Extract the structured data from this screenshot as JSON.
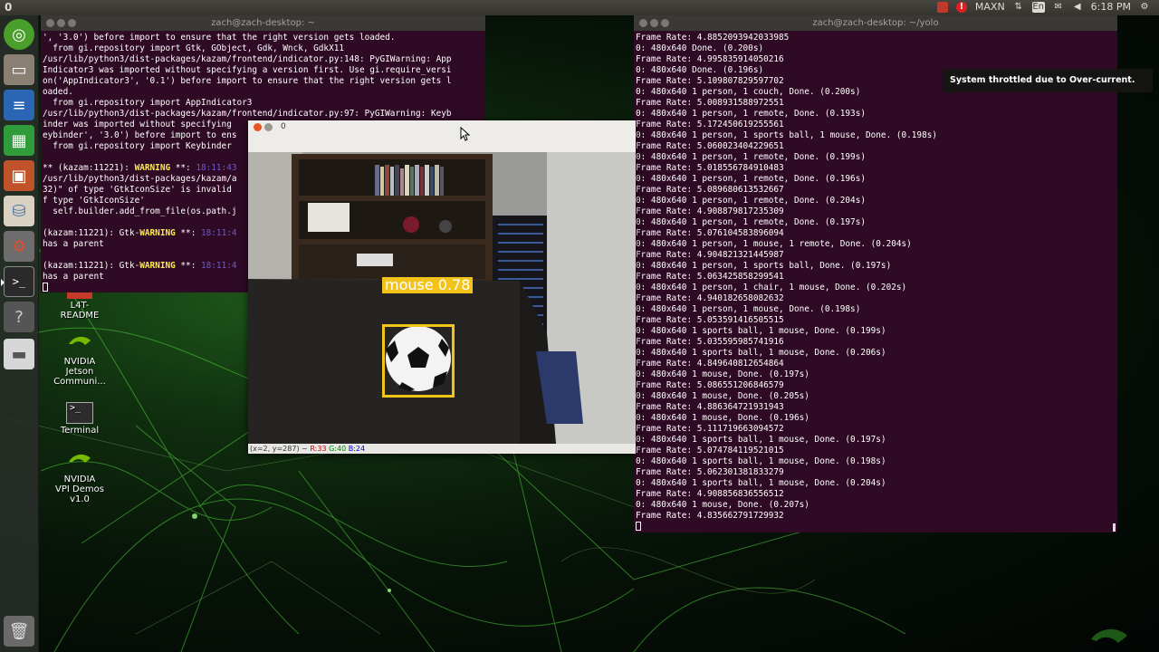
{
  "top_panel": {
    "left_label": "0",
    "network": "MAXN",
    "keyboard": "En",
    "clock": "6:18 PM"
  },
  "launcher": {
    "icons": [
      "ubuntu-logo-icon",
      "files-icon",
      "writer-icon",
      "calc-icon",
      "impress-icon",
      "software-center-icon",
      "settings-icon",
      "terminal-icon",
      "help-icon",
      "drive-icon",
      "trash-icon"
    ]
  },
  "desktop_icons": [
    {
      "label": "L4T-\nREADME",
      "icon": "readme-icon"
    },
    {
      "label": "NVIDIA\nJetson\nCommuni...",
      "icon": "nvidia-icon"
    },
    {
      "label": "Terminal",
      "icon": "terminal-icon"
    },
    {
      "label": "NVIDIA\nVPI Demos\nv1.0",
      "icon": "nvidia-icon"
    }
  ],
  "left_terminal": {
    "title": "zach@zach-desktop: ~",
    "lines": [
      "', '3.0') before import to ensure that the right version gets loaded.",
      "  from gi.repository import Gtk, GObject, Gdk, Wnck, GdkX11",
      "/usr/lib/python3/dist-packages/kazam/frontend/indicator.py:148: PyGIWarning: App",
      "Indicator3 was imported without specifying a version first. Use gi.require_versi",
      "on('AppIndicator3', '0.1') before import to ensure that the right version gets l",
      "oaded.",
      "  from gi.repository import AppIndicator3",
      "/usr/lib/python3/dist-packages/kazam/frontend/indicator.py:97: PyGIWarning: Keyb",
      "inder was imported without specifying",
      "eybinder', '3.0') before import to ens",
      "  from gi.repository import Keybinder",
      "",
      "** (kazam:11221): WARNING **: 18:11:43",
      "/usr/lib/python3/dist-packages/kazam/a",
      "32)\" of type 'GtkIconSize' is invalid",
      "f type 'GtkIconSize'",
      "  self.builder.add_from_file(os.path.j",
      "",
      "(kazam:11221): Gtk-WARNING **: 18:11:4",
      "has a parent",
      "",
      "(kazam:11221): Gtk-WARNING **: 18:11:4",
      "has a parent"
    ]
  },
  "right_terminal": {
    "title": "zach@zach-desktop: ~/yolo",
    "lines": [
      "Frame Rate: 4.8852093942033985",
      "0: 480x640 Done. (0.200s)",
      "Frame Rate: 4.995835914050216",
      "0: 480x640 Done. (0.196s)",
      "Frame Rate: 5.109807829597702",
      "0: 480x640 1 person, 1 couch, Done. (0.200s)",
      "Frame Rate: 5.008931588972551",
      "0: 480x640 1 person, 1 remote, Done. (0.193s)",
      "Frame Rate: 5.172450619255561",
      "0: 480x640 1 person, 1 sports ball, 1 mouse, Done. (0.198s)",
      "Frame Rate: 5.060023404229651",
      "0: 480x640 1 person, 1 remote, Done. (0.199s)",
      "Frame Rate: 5.018556784910483",
      "0: 480x640 1 person, 1 remote, Done. (0.196s)",
      "Frame Rate: 5.089680613532667",
      "0: 480x640 1 person, 1 remote, Done. (0.204s)",
      "Frame Rate: 4.908879817235309",
      "0: 480x640 1 person, 1 remote, Done. (0.197s)",
      "Frame Rate: 5.076104583896094",
      "0: 480x640 1 person, 1 mouse, 1 remote, Done. (0.204s)",
      "Frame Rate: 4.904821321445987",
      "0: 480x640 1 person, 1 sports ball, Done. (0.197s)",
      "Frame Rate: 5.063425858299541",
      "0: 480x640 1 person, 1 chair, 1 mouse, Done. (0.202s)",
      "Frame Rate: 4.940182658082632",
      "0: 480x640 1 person, 1 mouse, Done. (0.198s)",
      "Frame Rate: 5.053591416505515",
      "0: 480x640 1 sports ball, 1 mouse, Done. (0.199s)",
      "Frame Rate: 5.035595985741916",
      "0: 480x640 1 sports ball, 1 mouse, Done. (0.206s)",
      "Frame Rate: 4.849640812654864",
      "0: 480x640 1 mouse, Done. (0.197s)",
      "Frame Rate: 5.086551206846579",
      "0: 480x640 1 mouse, Done. (0.205s)",
      "Frame Rate: 4.886364721931943",
      "0: 480x640 1 mouse, Done. (0.196s)",
      "Frame Rate: 5.111719663094572",
      "0: 480x640 1 sports ball, 1 mouse, Done. (0.197s)",
      "Frame Rate: 5.074784119521015",
      "0: 480x640 1 sports ball, 1 mouse, Done. (0.198s)",
      "Frame Rate: 5.062301381833279",
      "0: 480x640 1 sports ball, 1 mouse, Done. (0.204s)",
      "Frame Rate: 4.908856836556512",
      "0: 480x640 1 mouse, Done. (0.207s)",
      "Frame Rate: 4.835662791729932"
    ]
  },
  "notification": {
    "text": "System throttled due to Over-current."
  },
  "camera_window": {
    "title": "0",
    "detection_label": "mouse  0.78",
    "box_color": "#f2c41a",
    "status": {
      "coords": "(x=2, y=287) ~ ",
      "r": "R:33",
      "g": "G:40",
      "b": "B:24"
    }
  }
}
